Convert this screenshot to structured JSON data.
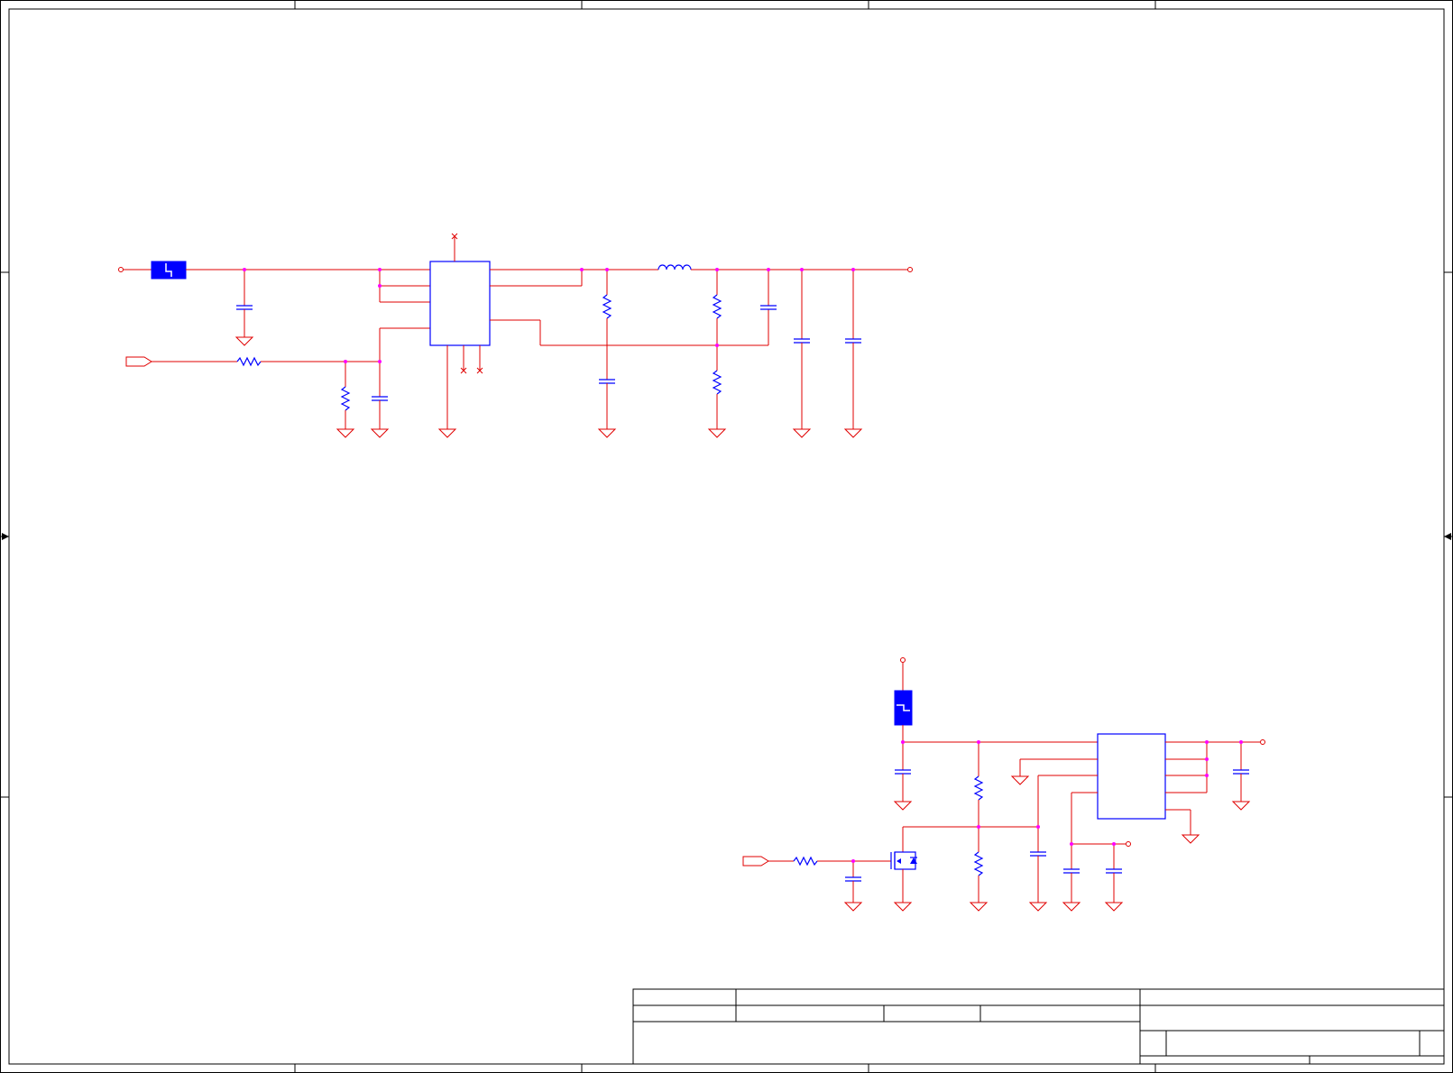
{
  "sheet": {
    "colors": {
      "frame": "#000000",
      "wire": "#e00000",
      "component": "#0000ff",
      "junction": "#ff00ff",
      "background": "#ffffff"
    }
  },
  "title_block": {
    "title": "",
    "size": "",
    "document_number": "",
    "revision": "",
    "date": "",
    "sheet": ""
  },
  "icons": [
    "fuse-icon",
    "capacitor-icon",
    "resistor-icon",
    "inductor-icon",
    "ground-icon",
    "mosfet-icon",
    "port-icon",
    "net-terminal-icon",
    "no-connect-icon",
    "ic-icon"
  ]
}
